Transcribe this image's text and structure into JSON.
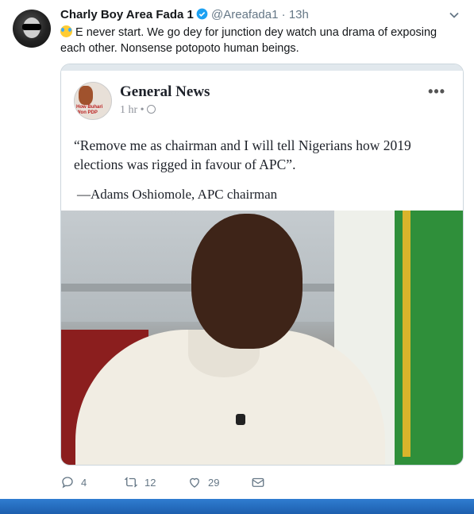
{
  "tweet": {
    "author_name": "Charly Boy Area Fada 1",
    "handle": "@Areafada1",
    "separator": "·",
    "time": "13h",
    "text": "E never start. We go dey for junction dey watch una drama of exposing each other. Nonsense potopoto human beings."
  },
  "card": {
    "page_name": "General News",
    "page_time": "1 hr",
    "page_meta_sep": "•",
    "more": "•••",
    "avatar_text": "How Buhari Won PDP",
    "quote": "“Remove me as chairman and I will tell Nigerians how 2019 elections was rigged in favour of APC”.",
    "attribution": "—Adams Oshiomole, APC chairman"
  },
  "actions": {
    "replies": "4",
    "retweets": "12",
    "likes": "29"
  },
  "colors": {
    "verified": "#1da1f2",
    "meta": "#657786",
    "taskbar": "#2f7dd1"
  },
  "icons": [
    "verified-badge-icon",
    "chevron-down-icon",
    "laughing-emoji-icon",
    "globe-icon",
    "reply-icon",
    "retweet-icon",
    "like-icon",
    "direct-message-icon"
  ]
}
